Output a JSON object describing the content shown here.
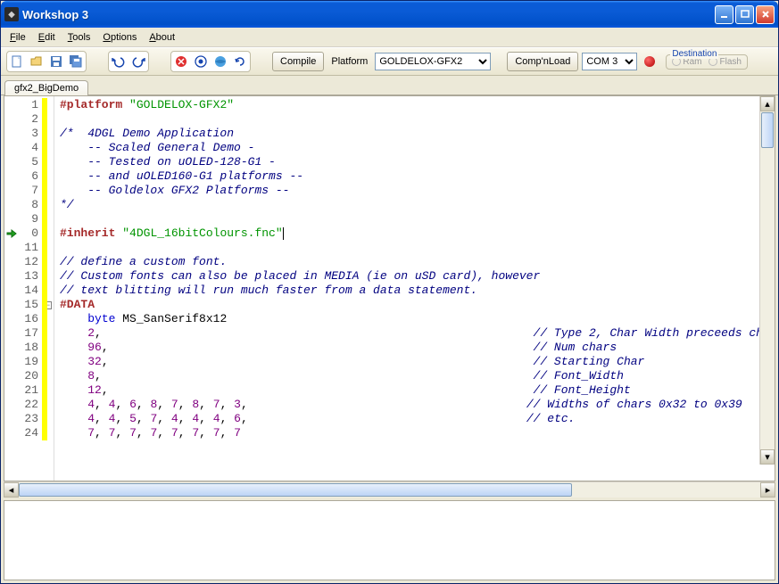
{
  "window": {
    "title": "Workshop 3"
  },
  "menu": {
    "file": "File",
    "edit": "Edit",
    "tools": "Tools",
    "options": "Options",
    "about": "About"
  },
  "toolbar": {
    "compile": "Compile",
    "platform_label": "Platform",
    "platform_value": "GOLDELOX-GFX2",
    "compnload": "Comp'nLoad",
    "com_value": "COM 3",
    "destination_label": "Destination",
    "dest_ram": "Ram",
    "dest_flash": "Flash"
  },
  "tabs": {
    "active": "gfx2_BigDemo"
  },
  "code": {
    "lines": [
      {
        "n": "1",
        "segs": [
          {
            "c": "kw-brown",
            "t": "#platform"
          },
          {
            "t": " "
          },
          {
            "c": "str-green",
            "t": "\"GOLDELOX-GFX2\""
          }
        ]
      },
      {
        "n": "2",
        "segs": []
      },
      {
        "n": "3",
        "segs": [
          {
            "c": "cmt-navy",
            "t": "/*  4DGL Demo Application"
          }
        ]
      },
      {
        "n": "4",
        "segs": [
          {
            "c": "cmt-navy",
            "t": "    -- Scaled General Demo -"
          }
        ]
      },
      {
        "n": "5",
        "segs": [
          {
            "c": "cmt-navy",
            "t": "    -- Tested on uOLED-128-G1 -"
          }
        ]
      },
      {
        "n": "6",
        "segs": [
          {
            "c": "cmt-navy",
            "t": "    -- and uOLED160-G1 platforms --"
          }
        ]
      },
      {
        "n": "7",
        "segs": [
          {
            "c": "cmt-navy",
            "t": "    -- Goldelox GFX2 Platforms --"
          }
        ]
      },
      {
        "n": "8",
        "segs": [
          {
            "c": "cmt-navy",
            "t": "*/"
          }
        ]
      },
      {
        "n": "9",
        "segs": []
      },
      {
        "n": "0",
        "mark": "arrow",
        "segs": [
          {
            "c": "kw-brown",
            "t": "#inherit"
          },
          {
            "t": " "
          },
          {
            "c": "str-green",
            "t": "\"4DGL_16bitColours.fnc\""
          },
          {
            "caret": true
          }
        ]
      },
      {
        "n": "11",
        "segs": []
      },
      {
        "n": "12",
        "segs": [
          {
            "c": "cmt-navy",
            "t": "// define a custom font."
          }
        ]
      },
      {
        "n": "13",
        "segs": [
          {
            "c": "cmt-navy",
            "t": "// Custom fonts can also be placed in MEDIA (ie on uSD card), however"
          }
        ]
      },
      {
        "n": "14",
        "segs": [
          {
            "c": "cmt-navy",
            "t": "// text blitting will run much faster from a data statement."
          }
        ]
      },
      {
        "n": "15",
        "fold": "minus",
        "segs": [
          {
            "c": "kw-brown",
            "t": "#DATA"
          }
        ]
      },
      {
        "n": "16",
        "segs": [
          {
            "t": "    "
          },
          {
            "c": "kw-blue",
            "t": "byte"
          },
          {
            "t": " MS_SanSerif8x12"
          }
        ]
      },
      {
        "n": "17",
        "segs": [
          {
            "t": "    "
          },
          {
            "c": "num-purple",
            "t": "2"
          },
          {
            "t": ","
          },
          {
            "pad": 62
          },
          {
            "c": "cmt-navy",
            "t": "// Type 2, Char Width preceeds ch"
          }
        ]
      },
      {
        "n": "18",
        "segs": [
          {
            "t": "    "
          },
          {
            "c": "num-purple",
            "t": "96"
          },
          {
            "t": ","
          },
          {
            "pad": 61
          },
          {
            "c": "cmt-navy",
            "t": "// Num chars"
          }
        ]
      },
      {
        "n": "19",
        "segs": [
          {
            "t": "    "
          },
          {
            "c": "num-purple",
            "t": "32"
          },
          {
            "t": ","
          },
          {
            "pad": 61
          },
          {
            "c": "cmt-navy",
            "t": "// Starting Char"
          }
        ]
      },
      {
        "n": "20",
        "segs": [
          {
            "t": "    "
          },
          {
            "c": "num-purple",
            "t": "8"
          },
          {
            "t": ","
          },
          {
            "pad": 62
          },
          {
            "c": "cmt-navy",
            "t": "// Font_Width"
          }
        ]
      },
      {
        "n": "21",
        "segs": [
          {
            "t": "    "
          },
          {
            "c": "num-purple",
            "t": "12"
          },
          {
            "t": ","
          },
          {
            "pad": 61
          },
          {
            "c": "cmt-navy",
            "t": "// Font_Height"
          }
        ]
      },
      {
        "n": "22",
        "segs": [
          {
            "t": "    "
          },
          {
            "c": "num-purple",
            "t": "4"
          },
          {
            "t": ", "
          },
          {
            "c": "num-purple",
            "t": "4"
          },
          {
            "t": ", "
          },
          {
            "c": "num-purple",
            "t": "6"
          },
          {
            "t": ", "
          },
          {
            "c": "num-purple",
            "t": "8"
          },
          {
            "t": ", "
          },
          {
            "c": "num-purple",
            "t": "7"
          },
          {
            "t": ", "
          },
          {
            "c": "num-purple",
            "t": "8"
          },
          {
            "t": ", "
          },
          {
            "c": "num-purple",
            "t": "7"
          },
          {
            "t": ", "
          },
          {
            "c": "num-purple",
            "t": "3"
          },
          {
            "t": ","
          },
          {
            "pad": 40
          },
          {
            "c": "cmt-navy",
            "t": "// Widths of chars 0x32 to 0x39"
          }
        ]
      },
      {
        "n": "23",
        "segs": [
          {
            "t": "    "
          },
          {
            "c": "num-purple",
            "t": "4"
          },
          {
            "t": ", "
          },
          {
            "c": "num-purple",
            "t": "4"
          },
          {
            "t": ", "
          },
          {
            "c": "num-purple",
            "t": "5"
          },
          {
            "t": ", "
          },
          {
            "c": "num-purple",
            "t": "7"
          },
          {
            "t": ", "
          },
          {
            "c": "num-purple",
            "t": "4"
          },
          {
            "t": ", "
          },
          {
            "c": "num-purple",
            "t": "4"
          },
          {
            "t": ", "
          },
          {
            "c": "num-purple",
            "t": "4"
          },
          {
            "t": ", "
          },
          {
            "c": "num-purple",
            "t": "6"
          },
          {
            "t": ","
          },
          {
            "pad": 40
          },
          {
            "c": "cmt-navy",
            "t": "// etc."
          }
        ]
      },
      {
        "n": "24",
        "segs": [
          {
            "t": "    "
          },
          {
            "c": "num-purple",
            "t": "7"
          },
          {
            "t": ", "
          },
          {
            "c": "num-purple",
            "t": "7"
          },
          {
            "t": ", "
          },
          {
            "c": "num-purple",
            "t": "7"
          },
          {
            "t": ", "
          },
          {
            "c": "num-purple",
            "t": "7"
          },
          {
            "t": ", "
          },
          {
            "c": "num-purple",
            "t": "7"
          },
          {
            "t": ", "
          },
          {
            "c": "num-purple",
            "t": "7"
          },
          {
            "t": ", "
          },
          {
            "c": "num-purple",
            "t": "7"
          },
          {
            "t": ", "
          },
          {
            "c": "num-purple",
            "t": "7"
          }
        ]
      }
    ]
  }
}
